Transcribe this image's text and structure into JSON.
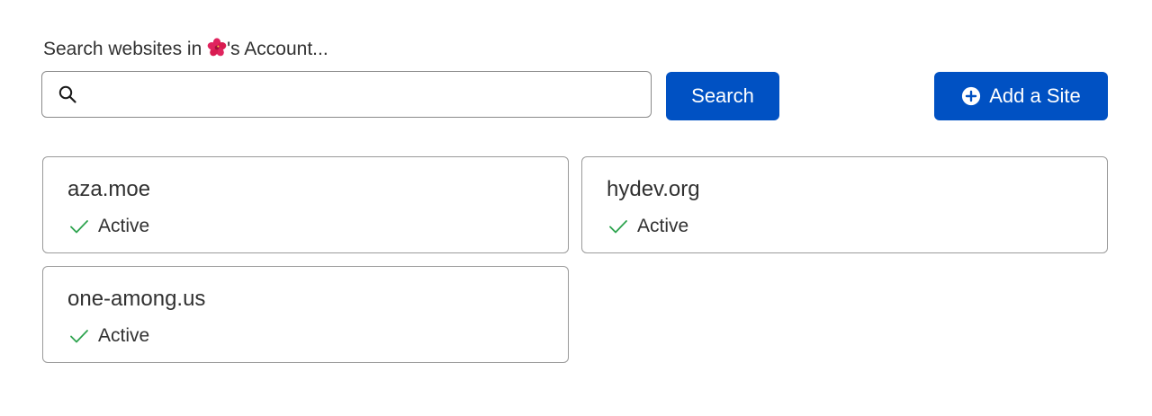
{
  "search": {
    "label_prefix": "Search websites in ",
    "label_suffix": "'s Account...",
    "account_emoji": "🌺",
    "value": "",
    "placeholder": "",
    "button_label": "Search"
  },
  "add_site": {
    "label": "Add a Site",
    "icon": "plus-circle-icon"
  },
  "sites": [
    {
      "domain": "aza.moe",
      "status": "Active",
      "status_icon": "check-icon"
    },
    {
      "domain": "hydev.org",
      "status": "Active",
      "status_icon": "check-icon"
    },
    {
      "domain": "one-among.us",
      "status": "Active",
      "status_icon": "check-icon"
    }
  ],
  "colors": {
    "primary_button": "#0051c3",
    "status_active": "#2ea44f",
    "text": "#313131",
    "border": "#9a9a9a"
  }
}
